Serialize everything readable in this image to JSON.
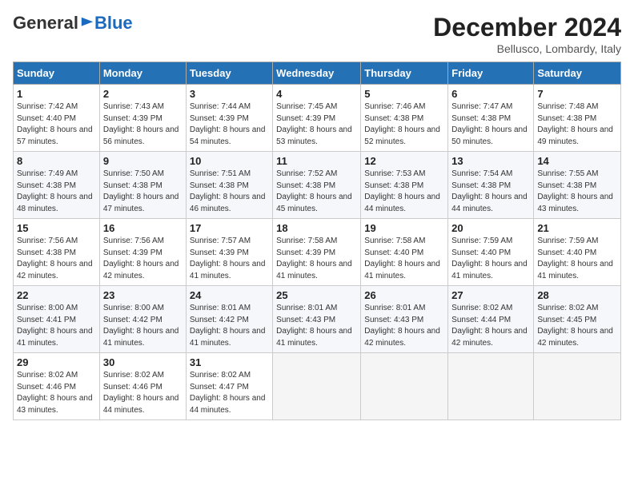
{
  "header": {
    "logo_general": "General",
    "logo_blue": "Blue",
    "month": "December 2024",
    "location": "Bellusco, Lombardy, Italy"
  },
  "weekdays": [
    "Sunday",
    "Monday",
    "Tuesday",
    "Wednesday",
    "Thursday",
    "Friday",
    "Saturday"
  ],
  "weeks": [
    [
      {
        "day": "1",
        "sunrise": "7:42 AM",
        "sunset": "4:40 PM",
        "daylight": "8 hours and 57 minutes."
      },
      {
        "day": "2",
        "sunrise": "7:43 AM",
        "sunset": "4:39 PM",
        "daylight": "8 hours and 56 minutes."
      },
      {
        "day": "3",
        "sunrise": "7:44 AM",
        "sunset": "4:39 PM",
        "daylight": "8 hours and 54 minutes."
      },
      {
        "day": "4",
        "sunrise": "7:45 AM",
        "sunset": "4:39 PM",
        "daylight": "8 hours and 53 minutes."
      },
      {
        "day": "5",
        "sunrise": "7:46 AM",
        "sunset": "4:38 PM",
        "daylight": "8 hours and 52 minutes."
      },
      {
        "day": "6",
        "sunrise": "7:47 AM",
        "sunset": "4:38 PM",
        "daylight": "8 hours and 50 minutes."
      },
      {
        "day": "7",
        "sunrise": "7:48 AM",
        "sunset": "4:38 PM",
        "daylight": "8 hours and 49 minutes."
      }
    ],
    [
      {
        "day": "8",
        "sunrise": "7:49 AM",
        "sunset": "4:38 PM",
        "daylight": "8 hours and 48 minutes."
      },
      {
        "day": "9",
        "sunrise": "7:50 AM",
        "sunset": "4:38 PM",
        "daylight": "8 hours and 47 minutes."
      },
      {
        "day": "10",
        "sunrise": "7:51 AM",
        "sunset": "4:38 PM",
        "daylight": "8 hours and 46 minutes."
      },
      {
        "day": "11",
        "sunrise": "7:52 AM",
        "sunset": "4:38 PM",
        "daylight": "8 hours and 45 minutes."
      },
      {
        "day": "12",
        "sunrise": "7:53 AM",
        "sunset": "4:38 PM",
        "daylight": "8 hours and 44 minutes."
      },
      {
        "day": "13",
        "sunrise": "7:54 AM",
        "sunset": "4:38 PM",
        "daylight": "8 hours and 44 minutes."
      },
      {
        "day": "14",
        "sunrise": "7:55 AM",
        "sunset": "4:38 PM",
        "daylight": "8 hours and 43 minutes."
      }
    ],
    [
      {
        "day": "15",
        "sunrise": "7:56 AM",
        "sunset": "4:38 PM",
        "daylight": "8 hours and 42 minutes."
      },
      {
        "day": "16",
        "sunrise": "7:56 AM",
        "sunset": "4:39 PM",
        "daylight": "8 hours and 42 minutes."
      },
      {
        "day": "17",
        "sunrise": "7:57 AM",
        "sunset": "4:39 PM",
        "daylight": "8 hours and 41 minutes."
      },
      {
        "day": "18",
        "sunrise": "7:58 AM",
        "sunset": "4:39 PM",
        "daylight": "8 hours and 41 minutes."
      },
      {
        "day": "19",
        "sunrise": "7:58 AM",
        "sunset": "4:40 PM",
        "daylight": "8 hours and 41 minutes."
      },
      {
        "day": "20",
        "sunrise": "7:59 AM",
        "sunset": "4:40 PM",
        "daylight": "8 hours and 41 minutes."
      },
      {
        "day": "21",
        "sunrise": "7:59 AM",
        "sunset": "4:40 PM",
        "daylight": "8 hours and 41 minutes."
      }
    ],
    [
      {
        "day": "22",
        "sunrise": "8:00 AM",
        "sunset": "4:41 PM",
        "daylight": "8 hours and 41 minutes."
      },
      {
        "day": "23",
        "sunrise": "8:00 AM",
        "sunset": "4:42 PM",
        "daylight": "8 hours and 41 minutes."
      },
      {
        "day": "24",
        "sunrise": "8:01 AM",
        "sunset": "4:42 PM",
        "daylight": "8 hours and 41 minutes."
      },
      {
        "day": "25",
        "sunrise": "8:01 AM",
        "sunset": "4:43 PM",
        "daylight": "8 hours and 41 minutes."
      },
      {
        "day": "26",
        "sunrise": "8:01 AM",
        "sunset": "4:43 PM",
        "daylight": "8 hours and 42 minutes."
      },
      {
        "day": "27",
        "sunrise": "8:02 AM",
        "sunset": "4:44 PM",
        "daylight": "8 hours and 42 minutes."
      },
      {
        "day": "28",
        "sunrise": "8:02 AM",
        "sunset": "4:45 PM",
        "daylight": "8 hours and 42 minutes."
      }
    ],
    [
      {
        "day": "29",
        "sunrise": "8:02 AM",
        "sunset": "4:46 PM",
        "daylight": "8 hours and 43 minutes."
      },
      {
        "day": "30",
        "sunrise": "8:02 AM",
        "sunset": "4:46 PM",
        "daylight": "8 hours and 44 minutes."
      },
      {
        "day": "31",
        "sunrise": "8:02 AM",
        "sunset": "4:47 PM",
        "daylight": "8 hours and 44 minutes."
      },
      null,
      null,
      null,
      null
    ]
  ]
}
